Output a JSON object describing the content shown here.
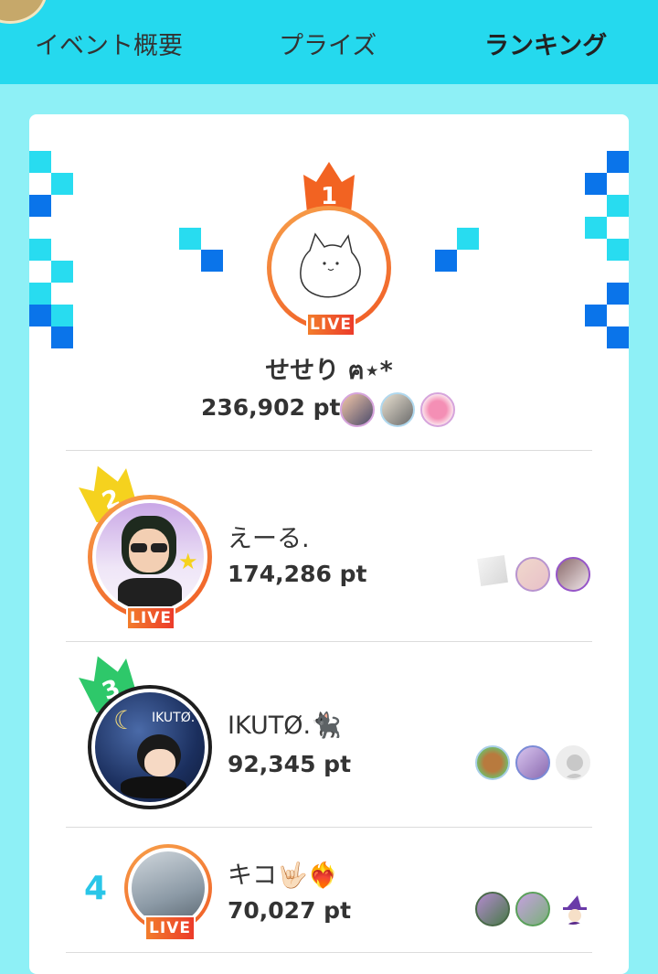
{
  "tabs": [
    {
      "label": "イベント概要"
    },
    {
      "label": "プライズ"
    },
    {
      "label": "ランキング",
      "active": true
    }
  ],
  "colors": {
    "accent": "#25d9ee",
    "background": "#8ef0f6",
    "live": "#f05a24",
    "gold": "#f5d21e",
    "green": "#2ec86a",
    "rank4": "#29c6e8"
  },
  "ranking": [
    {
      "rank": "1",
      "name": "せせり ฅ⋆*",
      "points": "236,902 pt",
      "live": "LIVE",
      "supporters": [
        "supporter-avatar",
        "supporter-avatar",
        "supporter-avatar"
      ]
    },
    {
      "rank": "2",
      "name": "えーる.",
      "points": "174,286 pt",
      "live": "LIVE",
      "supporters": [
        "supporter-avatar",
        "supporter-avatar",
        "supporter-avatar"
      ]
    },
    {
      "rank": "3",
      "name": "IKUTØ.🐈‍⬛",
      "points": "92,345 pt",
      "live": "",
      "supporters": [
        "supporter-avatar",
        "supporter-avatar",
        "supporter-avatar"
      ]
    },
    {
      "rank": "4",
      "name": "キコ🤟🏻❤️‍🔥",
      "points": "70,027 pt",
      "live": "LIVE",
      "supporters": [
        "supporter-avatar",
        "supporter-avatar",
        "supporter-avatar"
      ]
    }
  ]
}
